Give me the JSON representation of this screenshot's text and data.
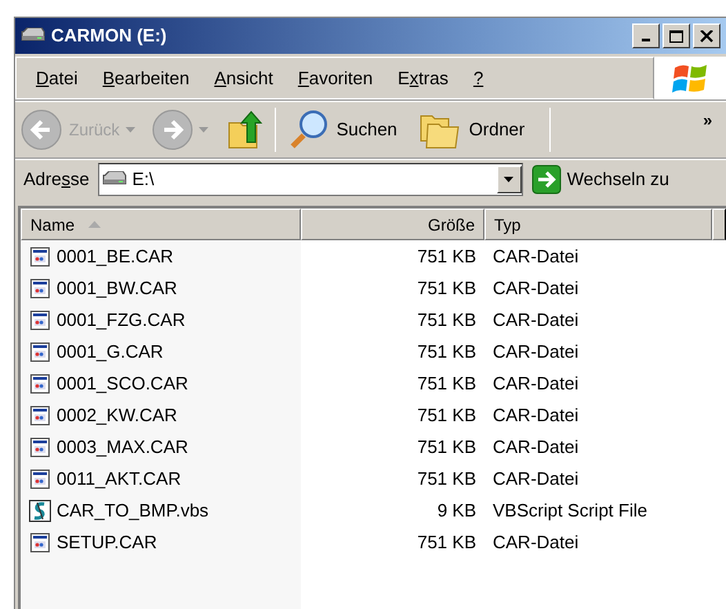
{
  "window": {
    "title": "CARMON (E:)"
  },
  "menu": [
    {
      "key": "D",
      "post": "atei"
    },
    {
      "key": "B",
      "post": "earbeiten"
    },
    {
      "key": "A",
      "post": "nsicht"
    },
    {
      "key": "F",
      "post": "avoriten"
    },
    {
      "pre": "E",
      "key": "x",
      "post": "tras"
    },
    {
      "key": "?"
    }
  ],
  "toolbar": {
    "back": {
      "label": "Zurück",
      "disabled": true
    },
    "forward": {
      "disabled": true
    },
    "search": "Suchen",
    "folders": "Ordner",
    "overflow": "»"
  },
  "address": {
    "label": {
      "pre": "Adre",
      "key": "s",
      "post": "se"
    },
    "value": "E:\\",
    "go": "Wechseln zu"
  },
  "columns": [
    {
      "label": "Name",
      "sorted": true
    },
    {
      "label": "Größe",
      "sorted": false
    },
    {
      "label": "Typ",
      "sorted": false
    }
  ],
  "rows": [
    {
      "name": "0001_BE.CAR",
      "size": "751 KB",
      "type": "CAR-Datei",
      "kind": "car"
    },
    {
      "name": "0001_BW.CAR",
      "size": "751 KB",
      "type": "CAR-Datei",
      "kind": "car"
    },
    {
      "name": "0001_FZG.CAR",
      "size": "751 KB",
      "type": "CAR-Datei",
      "kind": "car"
    },
    {
      "name": "0001_G.CAR",
      "size": "751 KB",
      "type": "CAR-Datei",
      "kind": "car"
    },
    {
      "name": "0001_SCO.CAR",
      "size": "751 KB",
      "type": "CAR-Datei",
      "kind": "car"
    },
    {
      "name": "0002_KW.CAR",
      "size": "751 KB",
      "type": "CAR-Datei",
      "kind": "car"
    },
    {
      "name": "0003_MAX.CAR",
      "size": "751 KB",
      "type": "CAR-Datei",
      "kind": "car"
    },
    {
      "name": "0011_AKT.CAR",
      "size": "751 KB",
      "type": "CAR-Datei",
      "kind": "car"
    },
    {
      "name": "CAR_TO_BMP.vbs",
      "size": "9 KB",
      "type": "VBScript Script File",
      "kind": "script"
    },
    {
      "name": "SETUP.CAR",
      "size": "751 KB",
      "type": "CAR-Datei",
      "kind": "car"
    }
  ]
}
